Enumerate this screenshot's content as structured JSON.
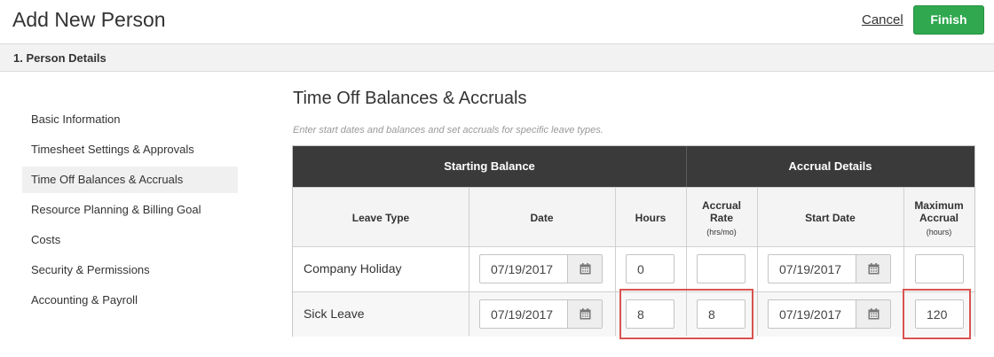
{
  "header": {
    "title": "Add New Person",
    "cancel_label": "Cancel",
    "finish_label": "Finish"
  },
  "section": {
    "title": "1. Person Details"
  },
  "sidebar": {
    "items": [
      {
        "label": "Basic Information"
      },
      {
        "label": "Timesheet Settings & Approvals"
      },
      {
        "label": "Time Off Balances & Accruals",
        "active": true
      },
      {
        "label": "Resource Planning & Billing Goal"
      },
      {
        "label": "Costs"
      },
      {
        "label": "Security & Permissions"
      },
      {
        "label": "Accounting & Payroll"
      }
    ]
  },
  "content": {
    "title": "Time Off Balances & Accruals",
    "subtitle": "Enter start dates and balances and set accruals for specific leave types."
  },
  "table": {
    "group_headers": {
      "starting_balance": "Starting Balance",
      "accrual_details": "Accrual Details"
    },
    "columns": {
      "leave_type": "Leave Type",
      "date": "Date",
      "hours": "Hours",
      "accrual_rate": "Accrual Rate",
      "accrual_rate_unit": "(hrs/mo)",
      "start_date": "Start Date",
      "max_accrual": "Maximum Accrual",
      "max_accrual_unit": "(hours)"
    },
    "rows": [
      {
        "leave_type": "Company Holiday",
        "date": "07/19/2017",
        "hours": "0",
        "accrual_rate": "",
        "start_date": "07/19/2017",
        "max_accrual": ""
      },
      {
        "leave_type": "Sick Leave",
        "date": "07/19/2017",
        "hours": "8",
        "accrual_rate": "8",
        "start_date": "07/19/2017",
        "max_accrual": "120"
      }
    ]
  },
  "colors": {
    "finish": "#2fa84f",
    "header_dark": "#3a3a3a",
    "highlight": "#d9534f"
  },
  "icons": {
    "calendar": "calendar-icon"
  }
}
